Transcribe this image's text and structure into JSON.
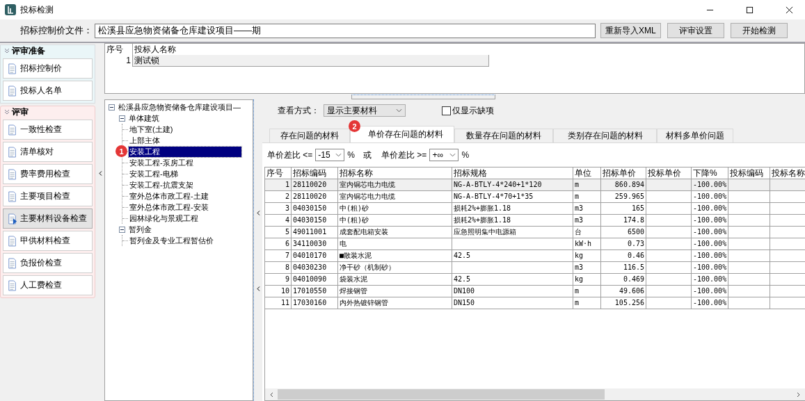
{
  "window": {
    "title": "投标检测"
  },
  "toolbar": {
    "file_label": "招标控制价文件：",
    "file_value": "松溪县应急物资储备仓库建设项目——期",
    "buttons": [
      "重新导入XML",
      "评审设置",
      "开始检测"
    ]
  },
  "sidebar": {
    "sections": [
      {
        "title": "评审准备",
        "items": [
          {
            "label": "招标控制价",
            "selected": false
          },
          {
            "label": "投标人名单",
            "selected": false
          }
        ]
      },
      {
        "title": "评审",
        "items": [
          {
            "label": "一致性检查",
            "selected": false
          },
          {
            "label": "清单核对",
            "selected": false
          },
          {
            "label": "费率费用检查",
            "selected": false
          },
          {
            "label": "主要项目检查",
            "selected": false
          },
          {
            "label": "主要材料设备检查",
            "selected": true
          },
          {
            "label": "甲供材料检查",
            "selected": false
          },
          {
            "label": "负报价检查",
            "selected": false
          },
          {
            "label": "人工费检查",
            "selected": false
          }
        ]
      }
    ]
  },
  "bidders": {
    "columns": [
      "序号",
      "投标人名称"
    ],
    "rows": [
      {
        "cells": [
          "1",
          "测试锁"
        ],
        "selected": true
      }
    ]
  },
  "tree": [
    {
      "label": "松溪县应急物资储备仓库建设项目—",
      "expanded": true,
      "selected": false,
      "children": [
        {
          "label": "单体建筑",
          "expanded": true,
          "selected": false,
          "children": [
            {
              "label": "地下室(土建)",
              "selected": false
            },
            {
              "label": "上部主体",
              "selected": false
            },
            {
              "label": "安装工程",
              "selected": true,
              "badge": "1"
            },
            {
              "label": "安装工程-泵房工程",
              "selected": false
            },
            {
              "label": "安装工程-电梯",
              "selected": false
            },
            {
              "label": "安装工程-抗震支架",
              "selected": false
            },
            {
              "label": "室外总体市政工程-土建",
              "selected": false
            },
            {
              "label": "室外总体市政工程-安装",
              "selected": false
            },
            {
              "label": "园林绿化与景观工程",
              "selected": false
            }
          ]
        },
        {
          "label": "暂列金",
          "expanded": true,
          "selected": false,
          "children": [
            {
              "label": "暂列金及专业工程暂估价",
              "selected": false
            }
          ]
        }
      ]
    }
  ],
  "view": {
    "label": "查看方式：",
    "value": "显示主要材料"
  },
  "missing_only": {
    "label": "仅显示缺项",
    "checked": false
  },
  "tabs": [
    {
      "label": "存在问题的材料",
      "selected": false
    },
    {
      "label": "单价存在问题的材料",
      "selected": true,
      "badge": "2"
    },
    {
      "label": "数量存在问题的材料",
      "selected": false
    },
    {
      "label": "类别存在问题的材料",
      "selected": false
    },
    {
      "label": "材料多单价问题",
      "selected": false
    }
  ],
  "filter": {
    "label_1": "单价差比 <=",
    "value_1": "-15",
    "unit_1": "%",
    "or": "或",
    "label_2": "单价差比 >=",
    "value_2": "+∞",
    "unit_2": "%"
  },
  "table": {
    "columns": [
      "序号",
      "招标编码",
      "招标名称",
      "招标规格",
      "单位",
      "招标单价",
      "投标单价",
      "下降%",
      "投标编码",
      "投标名称"
    ],
    "rows": [
      {
        "cells": [
          "1",
          "28110020",
          "室内铜芯电力电缆",
          "NG-A-BTLY-4*240+1*120",
          "m",
          "860.894",
          "",
          "-100.00%",
          "",
          ""
        ],
        "selected": true
      },
      {
        "cells": [
          "2",
          "28110020",
          "室内铜芯电力电缆",
          "NG-A-BTLY-4*70+1*35",
          "m",
          "259.965",
          "",
          "-100.00%",
          "",
          ""
        ],
        "selected": false
      },
      {
        "cells": [
          "3",
          "04030150",
          "中(粗)砂",
          "损耗2%+膨胀1.18",
          "m3",
          "165",
          "",
          "-100.00%",
          "",
          ""
        ],
        "selected": false
      },
      {
        "cells": [
          "4",
          "04030150",
          "中(粗)砂",
          "损耗2%+膨胀1.18",
          "m3",
          "174.8",
          "",
          "-100.00%",
          "",
          ""
        ],
        "selected": false
      },
      {
        "cells": [
          "5",
          "49011001",
          "成套配电箱安装",
          "应急照明集中电源箱",
          "台",
          "6500",
          "",
          "-100.00%",
          "",
          ""
        ],
        "selected": false
      },
      {
        "cells": [
          "6",
          "34110030",
          "电",
          "",
          "kW·h",
          "0.73",
          "",
          "-100.00%",
          "",
          ""
        ],
        "selected": false
      },
      {
        "cells": [
          "7",
          "04010170",
          "■散装水泥",
          "42.5",
          "kg",
          "0.46",
          "",
          "-100.00%",
          "",
          ""
        ],
        "selected": false
      },
      {
        "cells": [
          "8",
          "04030230",
          "净干砂（机制砂）",
          "",
          "m3",
          "116.5",
          "",
          "-100.00%",
          "",
          ""
        ],
        "selected": false
      },
      {
        "cells": [
          "9",
          "04010090",
          "袋装水泥",
          "42.5",
          "kg",
          "0.469",
          "",
          "-100.00%",
          "",
          ""
        ],
        "selected": false
      },
      {
        "cells": [
          "10",
          "17010550",
          "焊接钢管",
          "DN100",
          "m",
          "49.606",
          "",
          "-100.00%",
          "",
          ""
        ],
        "selected": false
      },
      {
        "cells": [
          "11",
          "17030160",
          "内外热镀锌钢管",
          "DN150",
          "m",
          "105.256",
          "",
          "-100.00%",
          "",
          ""
        ],
        "selected": false
      }
    ]
  }
}
